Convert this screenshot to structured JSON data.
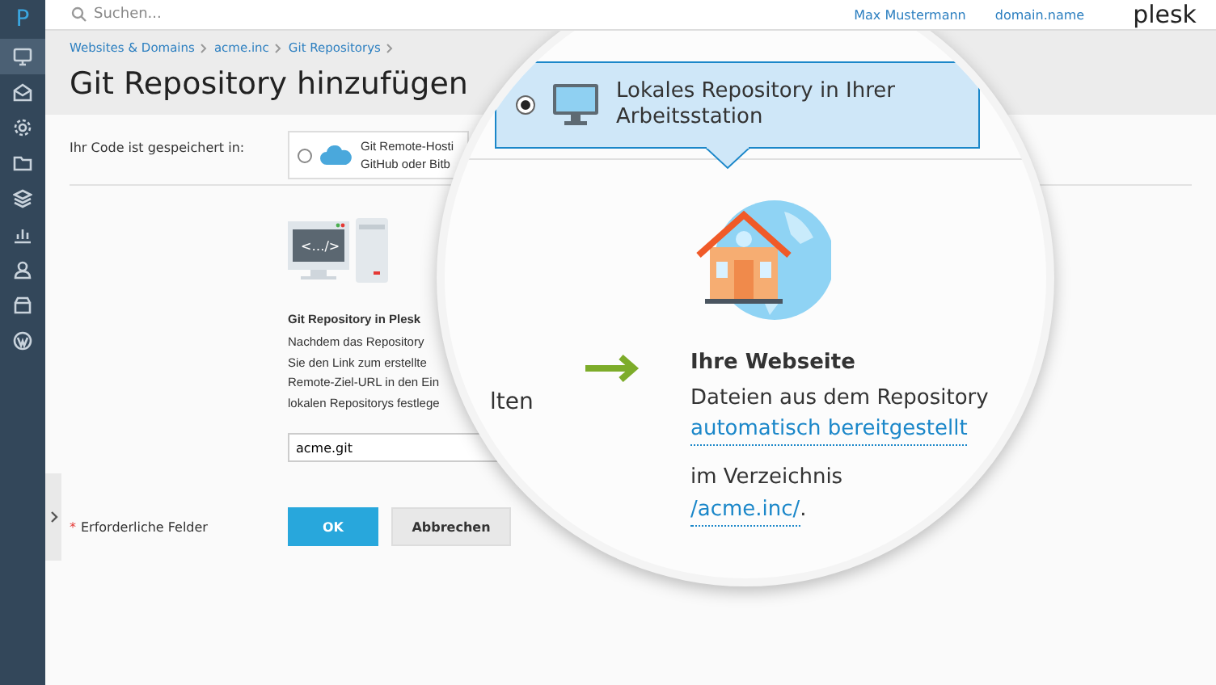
{
  "sidebar": {
    "logo": "P",
    "items": [
      {
        "kind": "monitor",
        "selected": true
      },
      {
        "kind": "mail",
        "selected": false
      },
      {
        "kind": "gear",
        "selected": false
      },
      {
        "kind": "folder",
        "selected": false
      },
      {
        "kind": "layers",
        "selected": false
      },
      {
        "kind": "chart",
        "selected": false
      },
      {
        "kind": "user",
        "selected": false
      },
      {
        "kind": "box",
        "selected": false
      },
      {
        "kind": "circle",
        "selected": false
      }
    ]
  },
  "top_bar": {
    "search": {
      "placeholder": "Suchen..."
    },
    "user": "Max Mustermann",
    "domain": "domain.name",
    "brand": "plesk"
  },
  "breadcrumbs": [
    "Websites & Domains",
    "acme.inc",
    "Git Repositorys"
  ],
  "title": "Git Repository hinzufügen",
  "form": {
    "source_label": "Ihr Code ist gespeichert in:",
    "options": [
      {
        "kind": "remote",
        "selected": false,
        "lines": [
          "Git Remote-Hosti",
          "GitHub oder Bitb"
        ]
      },
      {
        "kind": "local",
        "selected": true,
        "lines": [
          "Lokales Repository in Ihrer",
          "Arbeitsstation"
        ]
      }
    ],
    "plesk_panel": {
      "code_glyph": "<…/>",
      "title": "Git Repository in Plesk",
      "lines": [
        "Nachdem das Repository",
        "Sie den Link zum erstellte",
        "Remote-Ziel-URL in den Ein",
        "lokalen Repositorys festlege"
      ]
    },
    "repo_name": {
      "value": "acme.git"
    },
    "required_mark": "*",
    "required_note": "Erforderliche Felder",
    "buttons": [
      {
        "kind": "primary",
        "label": "OK"
      },
      {
        "kind": "secondary",
        "label": "Abbrechen"
      }
    ]
  },
  "magnifier": {
    "fragment": "lten",
    "website": {
      "title": "Ihre Webseite",
      "text": "Dateien aus dem Repository",
      "link": "automatisch bereitgestellt",
      "dir_text": "im Verzeichnis",
      "dir_link": "/acme.inc/",
      "dir_end": "."
    }
  }
}
